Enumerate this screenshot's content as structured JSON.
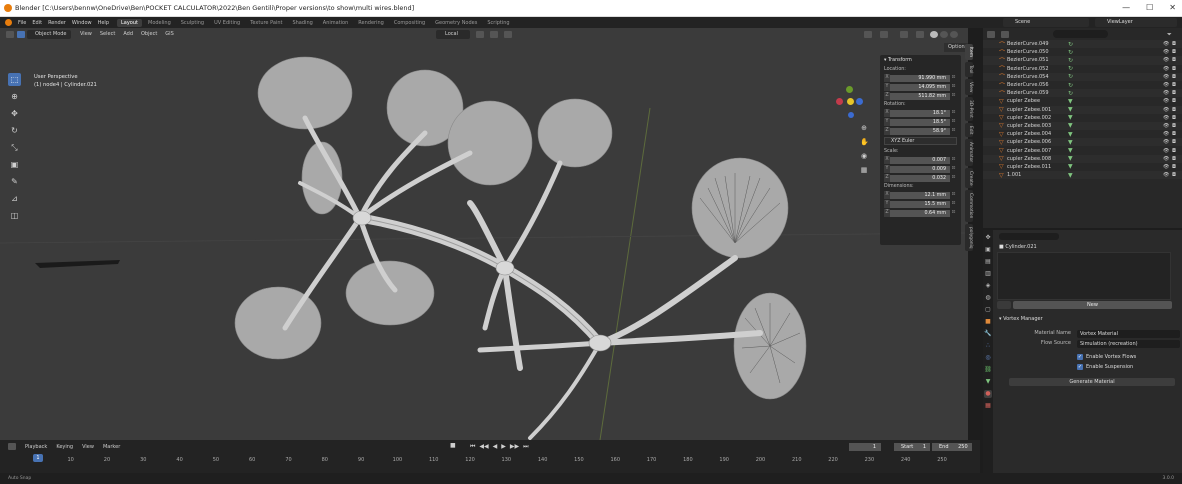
{
  "titlebar": {
    "title": "Blender [C:\\Users\\bennw\\OneDrive\\Ben\\POCKET CALCULATOR\\2022\\Ben Gentili\\Proper versions\\to show\\multi wires.blend]",
    "minimize": "—",
    "maximize": "☐",
    "close": "✕"
  },
  "topbar": {
    "menus": [
      "File",
      "Edit",
      "Render",
      "Window",
      "Help"
    ],
    "workspaces": [
      "Layout",
      "Modeling",
      "Sculpting",
      "UV Editing",
      "Texture Paint",
      "Shading",
      "Animation",
      "Rendering",
      "Compositing",
      "Geometry Nodes",
      "Scripting"
    ],
    "active_workspace": "Layout",
    "scene": "Scene",
    "view_layer": "ViewLayer"
  },
  "viewport": {
    "mode": "Object Mode",
    "menus": [
      "View",
      "Select",
      "Add",
      "Object",
      "GIS"
    ],
    "orientation": "Local",
    "options": "Options",
    "info_line1": "User Perspective",
    "info_line2": "(1) node4 | Cylinder.021"
  },
  "npanel": {
    "title": "Transform",
    "location_label": "Location:",
    "location": [
      {
        "axis": "X",
        "value": "91.990 mm"
      },
      {
        "axis": "Y",
        "value": "14.095 mm"
      },
      {
        "axis": "Z",
        "value": "511.82 mm"
      }
    ],
    "rotation_label": "Rotation:",
    "rotation": [
      {
        "axis": "X",
        "value": "18.1°"
      },
      {
        "axis": "Y",
        "value": "18.5°"
      },
      {
        "axis": "Z",
        "value": "58.9°"
      }
    ],
    "rotation_mode": "XYZ Euler",
    "scale_label": "Scale:",
    "scale": [
      {
        "axis": "X",
        "value": "0.007"
      },
      {
        "axis": "Y",
        "value": "0.009"
      },
      {
        "axis": "Z",
        "value": "0.032"
      }
    ],
    "dimensions_label": "Dimensions:",
    "dimensions": [
      {
        "axis": "X",
        "value": "12.1 mm"
      },
      {
        "axis": "Y",
        "value": "15.5 mm"
      },
      {
        "axis": "Z",
        "value": "0.64 mm"
      }
    ]
  },
  "sidetabs": [
    "Item",
    "Tool",
    "View",
    "3D-Print",
    "Edit",
    "Animator",
    "Create",
    "Commotion",
    "polygoniq"
  ],
  "outliner": {
    "items": [
      {
        "name": "BezierCurve.049",
        "kind": "curve"
      },
      {
        "name": "BezierCurve.050",
        "kind": "curve"
      },
      {
        "name": "BezierCurve.051",
        "kind": "curve"
      },
      {
        "name": "BezierCurve.052",
        "kind": "curve"
      },
      {
        "name": "BezierCurve.054",
        "kind": "curve"
      },
      {
        "name": "BezierCurve.056",
        "kind": "curve"
      },
      {
        "name": "BezierCurve.059",
        "kind": "curve"
      },
      {
        "name": "cupler Zebee",
        "kind": "mesh"
      },
      {
        "name": "cupler Zebee.001",
        "kind": "mesh"
      },
      {
        "name": "cupler Zebee.002",
        "kind": "mesh"
      },
      {
        "name": "cupler Zebee.003",
        "kind": "mesh"
      },
      {
        "name": "cupler Zebee.004",
        "kind": "mesh"
      },
      {
        "name": "cupler Zebee.006",
        "kind": "mesh"
      },
      {
        "name": "cupler Zebee.007",
        "kind": "mesh"
      },
      {
        "name": "cupler Zebee.008",
        "kind": "mesh"
      },
      {
        "name": "cupler Zebee.011",
        "kind": "mesh"
      },
      {
        "name": "1.001",
        "kind": "mesh"
      }
    ]
  },
  "properties": {
    "object_name": "Cylinder.021",
    "new_button": "New",
    "panel_title": "Vortex Manager",
    "material_name_label": "Material Name",
    "material_name_value": "Vortex Material",
    "flow_source_label": "Flow Source",
    "flow_source_value": "Simulation (recreation)",
    "check_vortex": "Enable Vortex Flows",
    "check_suspension": "Enable Suspension",
    "generate_button": "Generate Material"
  },
  "timeline": {
    "menus": [
      "Playback",
      "Keying",
      "View",
      "Marker"
    ],
    "current_frame": "1",
    "start_label": "Start",
    "start_value": "1",
    "end_label": "End",
    "end_value": "250",
    "ticks": [
      "10",
      "20",
      "30",
      "40",
      "50",
      "60",
      "70",
      "80",
      "90",
      "100",
      "110",
      "120",
      "130",
      "140",
      "150",
      "160",
      "170",
      "180",
      "190",
      "200",
      "210",
      "220",
      "230",
      "240",
      "250"
    ],
    "playhead": "1"
  },
  "statusbar": {
    "text": "Auto Snap",
    "version": "3.0.0"
  },
  "colors": {
    "accent": "#4772b3",
    "viewport_bg": "#3b3b3b",
    "curve_icon": "#e07a2c",
    "modifier_icon": "#7fc57f"
  }
}
